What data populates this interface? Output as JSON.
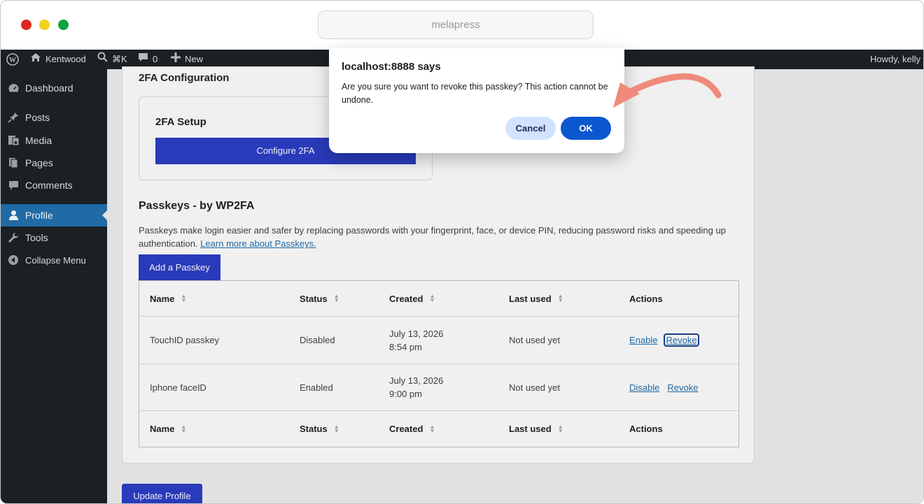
{
  "browser": {
    "url": "melapress"
  },
  "adminbar": {
    "site_name": "Kentwood",
    "shortcut": "⌘K",
    "comments_count": "0",
    "new_label": "New",
    "greeting": "Howdy, kelly"
  },
  "sidebar": {
    "items": [
      {
        "label": "Dashboard",
        "icon": "dashboard-icon"
      },
      {
        "label": "Posts",
        "icon": "pin-icon"
      },
      {
        "label": "Media",
        "icon": "media-icon"
      },
      {
        "label": "Pages",
        "icon": "pages-icon"
      },
      {
        "label": "Comments",
        "icon": "comment-icon"
      },
      {
        "label": "Profile",
        "icon": "user-icon"
      },
      {
        "label": "Tools",
        "icon": "wrench-icon"
      },
      {
        "label": "Collapse Menu",
        "icon": "collapse-icon"
      }
    ],
    "active": "Profile"
  },
  "twofa": {
    "heading": "2FA Configuration",
    "setup_title": "2FA Setup",
    "configure_button": "Configure 2FA"
  },
  "passkeys": {
    "heading": "Passkeys - by WP2FA",
    "description": "Passkeys make login easier and safer by replacing passwords with your fingerprint, face, or device PIN, reducing password risks and speeding up authentication.",
    "learn_more": "Learn more about Passkeys.",
    "add_button": "Add a Passkey",
    "columns": [
      "Name",
      "Status",
      "Created",
      "Last used",
      "Actions"
    ],
    "rows": [
      {
        "name": "TouchID passkey",
        "status": "Disabled",
        "created_date": "July 13, 2026",
        "created_time": "8:54 pm",
        "last_used": "Not used yet",
        "action_toggle": "Enable",
        "action_revoke": "Revoke"
      },
      {
        "name": "Iphone faceID",
        "status": "Enabled",
        "created_date": "July 13, 2026",
        "created_time": "9:00 pm",
        "last_used": "Not used yet",
        "action_toggle": "Disable",
        "action_revoke": "Revoke"
      }
    ]
  },
  "footer": {
    "update_button": "Update Profile"
  },
  "dialog": {
    "title": "localhost:8888 says",
    "message": "Are you sure you want to revoke this passkey? This action cannot be undone.",
    "cancel": "Cancel",
    "ok": "OK"
  },
  "colors": {
    "admin_dark": "#1d2327",
    "active_menu": "#2271b1",
    "primary_button": "#2c3ec6",
    "dialog_ok": "#0b57d0",
    "annotation_arrow": "#f08a7a"
  }
}
